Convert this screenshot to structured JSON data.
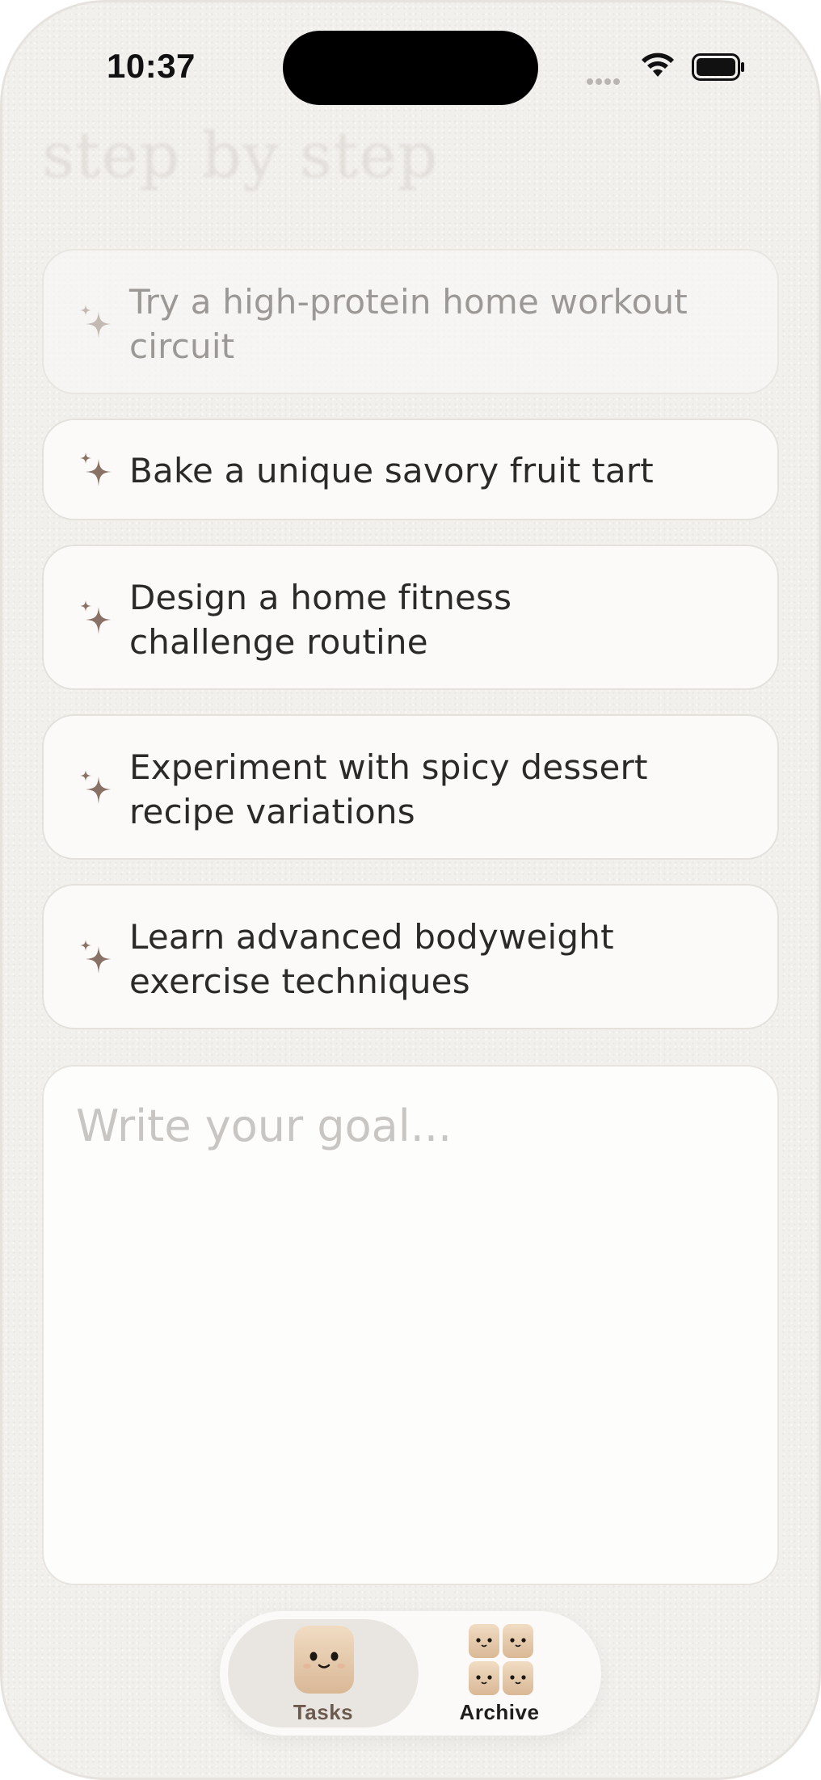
{
  "status_bar": {
    "time": "10:37"
  },
  "header": {
    "title": "step by step"
  },
  "suggestions": [
    {
      "text": "Try a high-protein home workout circuit"
    },
    {
      "text": "Bake a unique savory fruit tart"
    },
    {
      "text": "Design a home fitness challenge routine"
    },
    {
      "text": "Experiment with spicy dessert recipe variations"
    },
    {
      "text": "Learn advanced bodyweight exercise techniques"
    }
  ],
  "goal_input": {
    "placeholder": "Write your goal...",
    "value": ""
  },
  "tab_bar": {
    "tabs": [
      {
        "label": "Tasks",
        "selected": true
      },
      {
        "label": "Archive",
        "selected": false
      }
    ]
  },
  "colors": {
    "background": "#f2f0ed",
    "sparkle": "#8a7166",
    "selected_tab_label": "#6d5a4e",
    "placeholder": "#c8c6c3"
  },
  "icons": [
    "wifi-icon",
    "battery-icon",
    "signal-dots-icon",
    "sparkle-icon",
    "mascot-icon",
    "mascot-group-icon"
  ]
}
